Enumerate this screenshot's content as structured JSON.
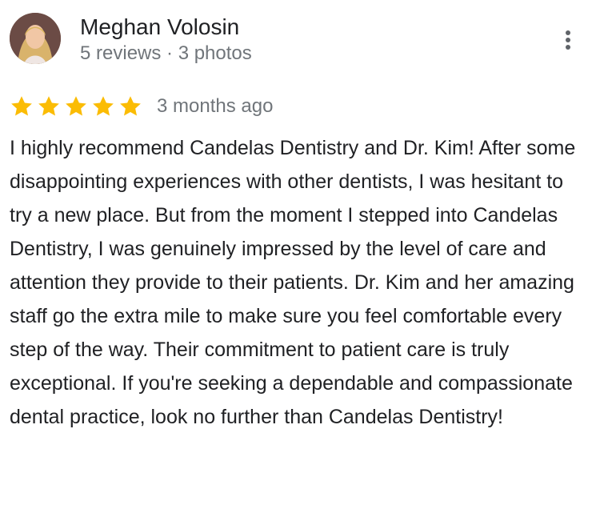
{
  "reviewer": {
    "name": "Meghan Volosin",
    "meta": "5 reviews · 3 photos",
    "avatar": "avatar-photo"
  },
  "more_menu": {
    "icon": "more-vertical-icon"
  },
  "rating": {
    "stars": 5,
    "max_stars": 5,
    "star_icon": "star-icon",
    "star_color": "#fbbc04",
    "date": "3 months ago"
  },
  "review": {
    "text": "I highly recommend Candelas Dentistry and Dr. Kim! After some disappointing experiences with other dentists, I was hesitant to try a new place. But from the moment I stepped into Candelas Dentistry, I was genuinely impressed by the level of care and attention they provide to their patients. Dr. Kim and her amazing staff go the extra mile to make sure you feel comfortable every step of the way. Their commitment to patient care is truly exceptional. If you're seeking a dependable and compassionate dental practice, look no further than Candelas Dentistry!"
  },
  "colors": {
    "primary_text": "#202124",
    "secondary_text": "#70757a",
    "star": "#fbbc04"
  }
}
